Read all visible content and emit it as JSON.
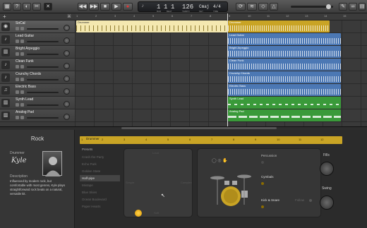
{
  "toolbar": {
    "rewind": "◀◀",
    "forward": "▶▶",
    "stop": "■",
    "play": "▶",
    "record": "●",
    "cycle": "⟳",
    "lcd": {
      "bar": "1",
      "beat": "1",
      "division": "1",
      "tempo": "126",
      "key": "Cmaj",
      "signature": "4/4",
      "bar_label": "BAR",
      "beat_label": "BEAT",
      "tempo_label": "TEMPO",
      "key_label": "KEY",
      "sig_label": "TIME"
    }
  },
  "ruler": {
    "numbers": [
      "1",
      "2",
      "3",
      "4",
      "5",
      "6",
      "7",
      "8",
      "9",
      "10",
      "11",
      "12",
      "13",
      "14",
      "15"
    ]
  },
  "tracks": [
    {
      "name": "SoCal",
      "icon": "drum-icon"
    },
    {
      "name": "Lead Guitar",
      "icon": "guitar-icon"
    },
    {
      "name": "Bright Arpeggio",
      "icon": "synth-icon"
    },
    {
      "name": "Clean Funk",
      "icon": "guitar-icon"
    },
    {
      "name": "Crunchy Chords",
      "icon": "guitar-icon"
    },
    {
      "name": "Electric Bass",
      "icon": "bass-icon"
    },
    {
      "name": "Synth Lead",
      "icon": "synth-icon"
    },
    {
      "name": "Analog Pad",
      "icon": "synth-icon"
    }
  ],
  "regions": {
    "drummer_a": "Drummer",
    "drummer_b": "Drummer",
    "lead_guitar": "Lead Guitar",
    "bright_arpeggio": "Bright Arpeggio",
    "clean_funk": "Clean Funk",
    "crunchy_chords": "Crunchy Chords",
    "electric_bass": "Electric Bass",
    "synth_lead": "Synth Lead",
    "analog_pad": "Analog Pad"
  },
  "library": {
    "title": "Rock",
    "drummer_label": "Drummer",
    "drummer_name": "Kyle",
    "description_label": "Description",
    "description": "Influenced by modern rock, but comfortable with most genres, Kyle plays straightforward rock beats on a natural, versatile kit."
  },
  "editor": {
    "region_label": "Drummer",
    "ruler": [
      "1",
      "2",
      "3",
      "4",
      "5",
      "6",
      "7",
      "8",
      "9",
      "10",
      "11",
      "12"
    ],
    "presets_label": "Presets",
    "presets": [
      "Crash the Party",
      "Echo Park",
      "Golden State",
      "Half-pipe",
      "Mixtape",
      "Blue Skies",
      "Ocean Boulevard",
      "Paper Hearts"
    ],
    "active_preset_index": 3,
    "xy_top": "Loud",
    "xy_bottom": "Soft",
    "xy_left": "Simple",
    "xy_right": "Complex",
    "percussion": "Percussion",
    "cymbals": "Cymbals",
    "kick_snare": "Kick & Snare",
    "follow": "Follow",
    "fills": "Fills",
    "swing": "Swing"
  },
  "colors": {
    "drummer": "#c9a425",
    "audio": "#4c78b4",
    "midi": "#3a9a3a"
  }
}
